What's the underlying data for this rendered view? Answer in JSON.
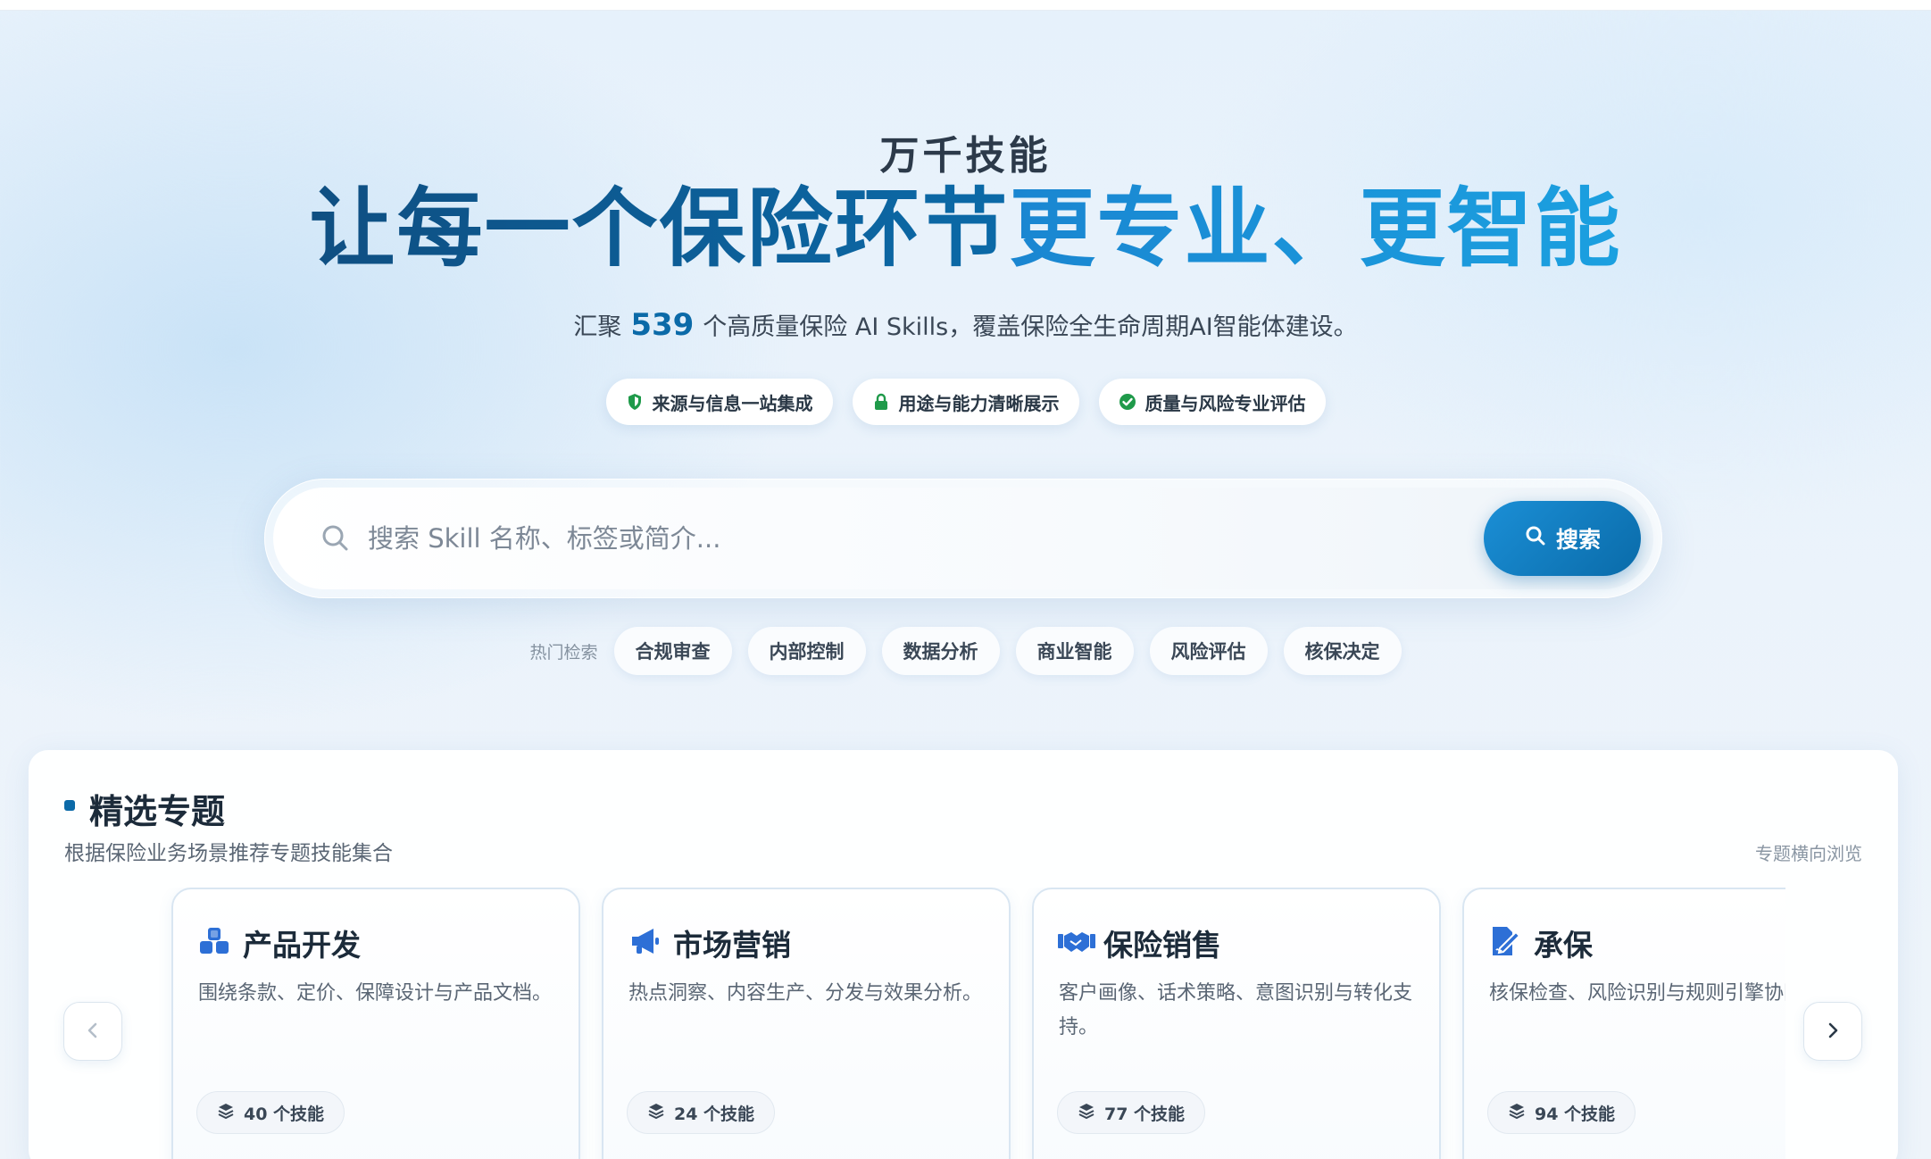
{
  "hero": {
    "eyebrow": "万千技能",
    "headline_dark": "让每一个保险环节",
    "headline_light": "更专业、更智能",
    "subline_prefix": "汇聚",
    "subline_count": "539",
    "subline_suffix": "个高质量保险 AI Skills，覆盖保险全生命周期AI智能体建设。",
    "features": [
      {
        "label": "来源与信息一站集成",
        "icon": "shield-icon"
      },
      {
        "label": "用途与能力清晰展示",
        "icon": "lock-icon"
      },
      {
        "label": "质量与风险专业评估",
        "icon": "check-circle-icon"
      }
    ]
  },
  "search": {
    "placeholder": "搜索 Skill 名称、标签或简介...",
    "value": "",
    "button_label": "搜索"
  },
  "hot_search": {
    "label": "热门检索",
    "tags": [
      "合规审查",
      "内部控制",
      "数据分析",
      "商业智能",
      "风险评估",
      "核保决定"
    ]
  },
  "featured": {
    "title": "精选专题",
    "subtitle": "根据保险业务场景推荐专题技能集合",
    "hint": "专题横向浏览",
    "cards": [
      {
        "title": "产品开发",
        "desc": "围绕条款、定价、保障设计与产品文档。",
        "count": "40 个技能",
        "icon": "cubes-icon"
      },
      {
        "title": "市场营销",
        "desc": "热点洞察、内容生产、分发与效果分析。",
        "count": "24 个技能",
        "icon": "megaphone-icon"
      },
      {
        "title": "保险销售",
        "desc": "客户画像、话术策略、意图识别与转化支持。",
        "count": "77 个技能",
        "icon": "handshake-icon"
      },
      {
        "title": "承保",
        "desc": "核保检查、风险识别与规则引擎协同",
        "count": "94 个技能",
        "icon": "file-signature-icon"
      }
    ]
  },
  "colors": {
    "accent": "#0b6aa8",
    "accent_light": "#1ba0e0",
    "feature_icon": "#1f9a4a"
  }
}
